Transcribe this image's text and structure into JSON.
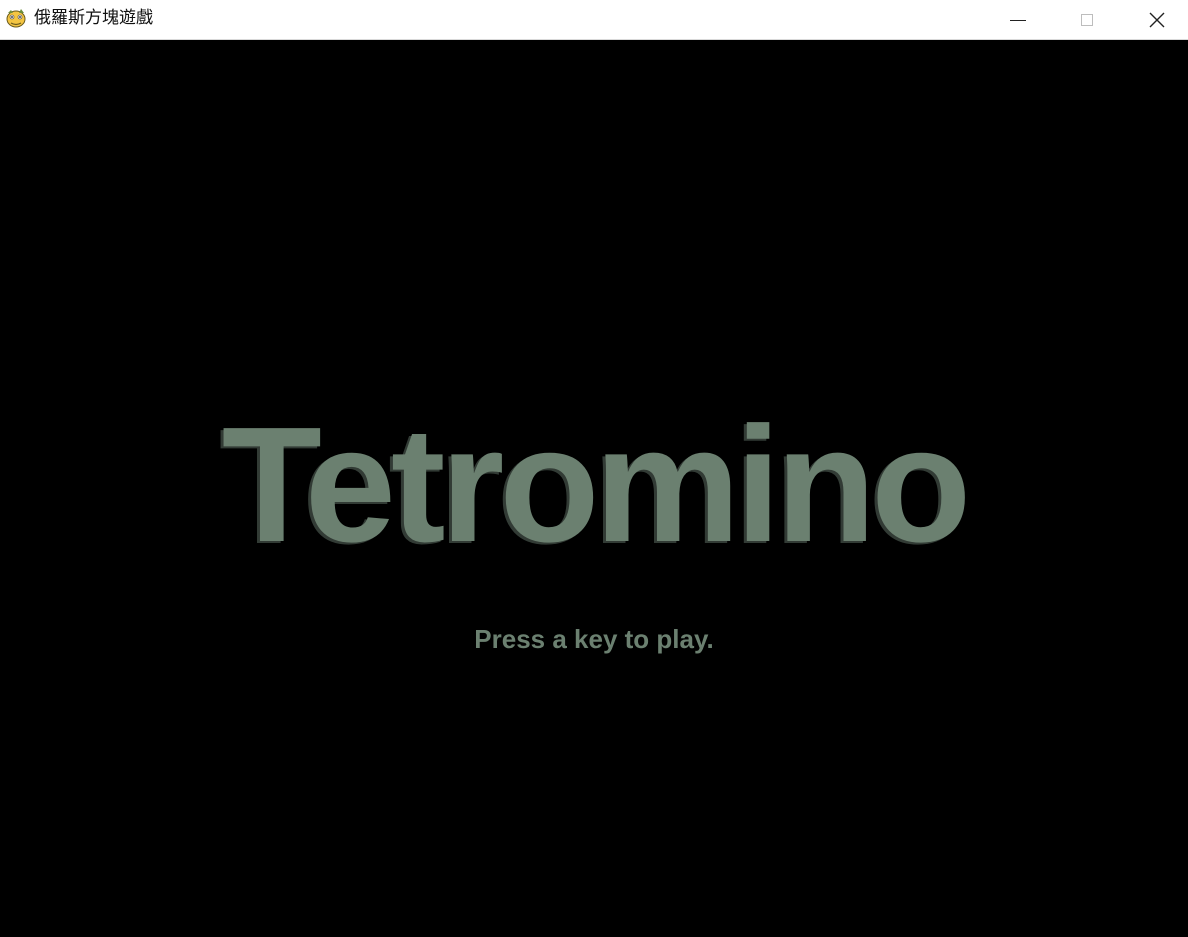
{
  "window": {
    "title": "俄羅斯方塊遊戲",
    "icon": "pygame-snake-icon",
    "controls": {
      "minimize_icon": "minimize-icon",
      "maximize_icon": "maximize-icon",
      "close_icon": "close-icon"
    }
  },
  "game": {
    "title": "Tetromino",
    "prompt": "Press a key to play.",
    "colors": {
      "background": "#000000",
      "text": "#6b8070",
      "text_shadow": "#3b463f"
    }
  }
}
